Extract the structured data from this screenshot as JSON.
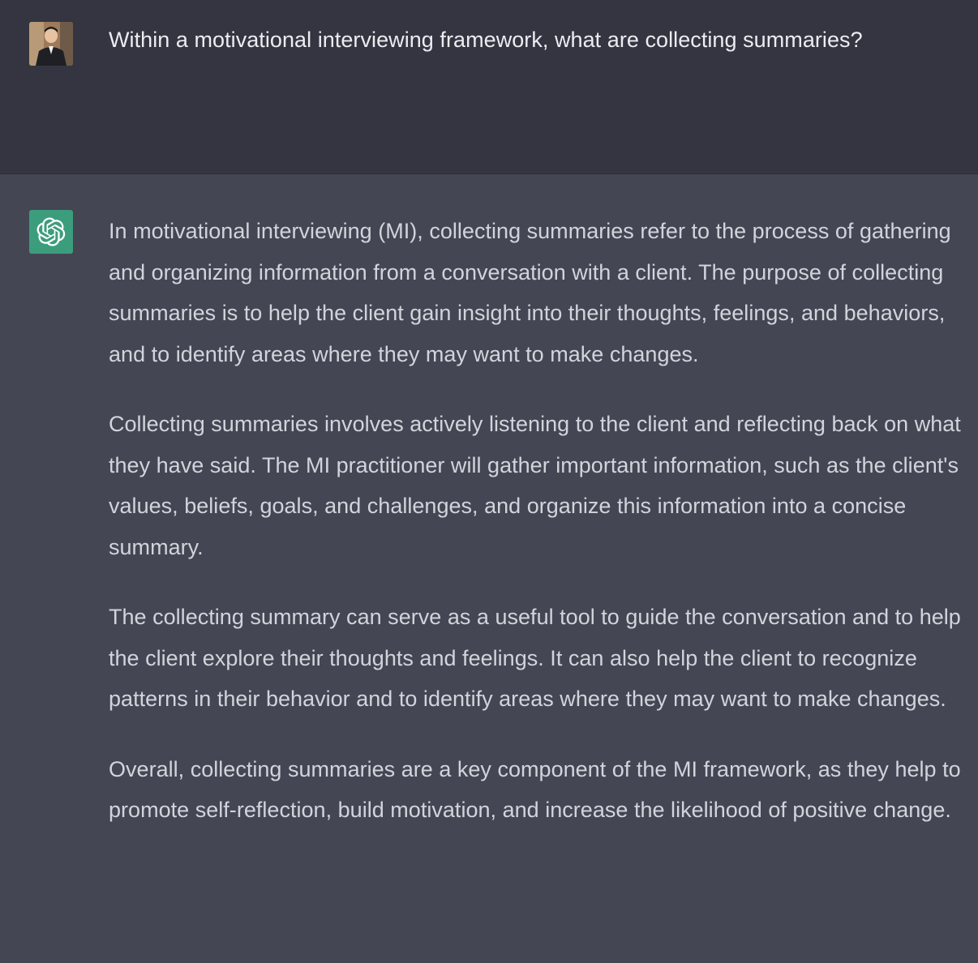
{
  "conversation": {
    "user_message": {
      "avatar": "user-photo-avatar",
      "text": "Within a motivational interviewing framework, what are collecting summaries?"
    },
    "assistant_message": {
      "avatar": "openai-logo-icon",
      "paragraphs": [
        "In motivational interviewing (MI), collecting summaries refer to the process of gathering and organizing information from a conversation with a client. The purpose of collecting summaries is to help the client gain insight into their thoughts, feelings, and behaviors, and to identify areas where they may want to make changes.",
        "Collecting summaries involves actively listening to the client and reflecting back on what they have said. The MI practitioner will gather important information, such as the client's values, beliefs, goals, and challenges, and organize this information into a concise summary.",
        "The collecting summary can serve as a useful tool to guide the conversation and to help the client explore their thoughts and feelings. It can also help the client to recognize patterns in their behavior and to identify areas where they may want to make changes.",
        "Overall, collecting summaries are a key component of the MI framework, as they help to promote self-reflection, build motivation, and increase the likelihood of positive change."
      ]
    }
  },
  "colors": {
    "user_bg": "#343541",
    "assistant_bg": "#444654",
    "ai_avatar_bg": "#3c9d7d",
    "user_text": "#ececf1",
    "assistant_text": "#d1d5db"
  }
}
